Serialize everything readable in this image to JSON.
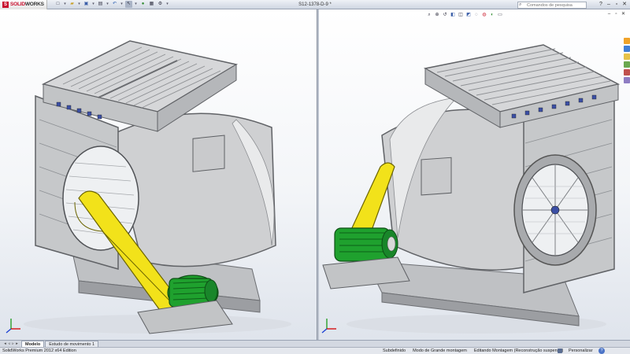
{
  "app": {
    "name": "SolidWorks",
    "brand_prefix": "SOLID",
    "brand_suffix": "WORKS",
    "doc_title": "S12-1378-D-9 *"
  },
  "toolbar": {
    "icons": [
      "new-icon",
      "open-icon",
      "save-icon",
      "print-icon",
      "undo-icon",
      "select-icon",
      "rebuild-icon",
      "file-properties-icon",
      "options-icon"
    ]
  },
  "search": {
    "placeholder": "Comandos de pesquisa"
  },
  "window_controls": [
    "help-icon",
    "minimize-icon",
    "restore-icon",
    "close-icon"
  ],
  "viewports": {
    "heads_up_icons": [
      "zoom-to-fit-icon",
      "zoom-area-icon",
      "previous-view-icon",
      "section-view-icon",
      "view-orientation-icon",
      "display-style-icon",
      "hide-show-icon",
      "edit-appearance-icon",
      "apply-scene-icon",
      "view-settings-icon"
    ]
  },
  "tabs": [
    {
      "label": "Modelo",
      "active": true
    },
    {
      "label": "Estudo de movimento 1",
      "active": false
    }
  ],
  "status": {
    "app_edition": "SolidWorks Premium 2012 x64 Edition",
    "items": [
      "Subdefinido",
      "Modo de Grande montagem",
      "Editando Montagem (Reconstrução suspensa)"
    ],
    "customize": "Personalizar",
    "help": "?"
  },
  "colors": {
    "belt_guard": "#f2e21a",
    "motor": "#1fa12e",
    "housing": "#c9cacb",
    "frame": "#b8b9bc",
    "background_top": "#ffffff",
    "background_bottom": "#dfe4ec",
    "axis_x": "#d40000",
    "axis_y": "#1a9a1a",
    "axis_z": "#1a3fd4"
  }
}
